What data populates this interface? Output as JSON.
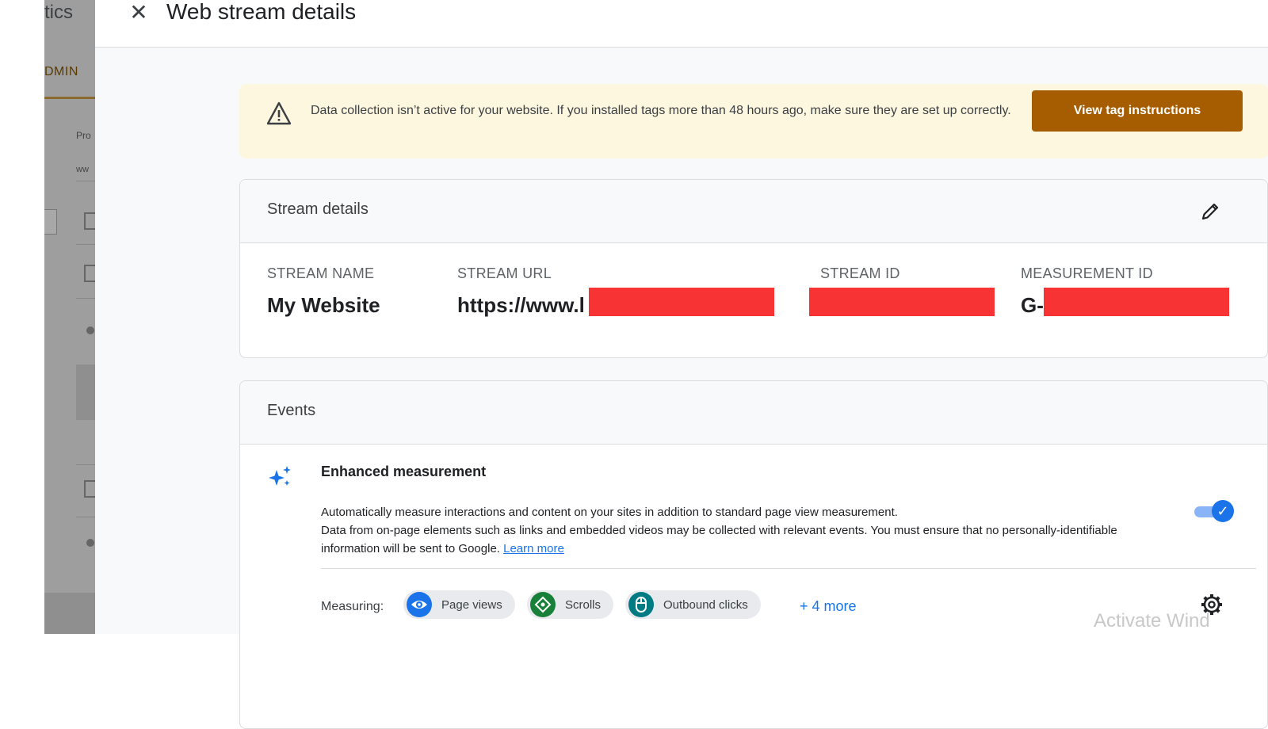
{
  "background_app": {
    "title_fragment": "tics",
    "tab_fragment": "DMIN",
    "label1": "Pro",
    "label2": "ww"
  },
  "panel": {
    "title": "Web stream details",
    "close_symbol": "✕"
  },
  "banner": {
    "message": "Data collection isn’t active for your website. If you installed tags more than 48 hours ago, make sure they are set up correctly.",
    "button_label": "View tag instructions",
    "icon": "warning-triangle-icon"
  },
  "stream_details": {
    "title": "Stream details",
    "fields": [
      {
        "label": "STREAM NAME",
        "value": "My Website"
      },
      {
        "label": "STREAM URL",
        "value": "https://www.l"
      },
      {
        "label": "STREAM ID",
        "value": ""
      },
      {
        "label": "MEASUREMENT ID",
        "value": "G-"
      }
    ]
  },
  "events": {
    "title": "Events",
    "enhanced": {
      "title": "Enhanced measurement",
      "desc_line1": "Automatically measure interactions and content on your sites in addition to standard page view measurement.",
      "desc_line2": "Data from on-page elements such as links and embedded videos may be collected with relevant events. You must ensure that no personally-identifiable information will be sent to Google.",
      "learn_more": "Learn more",
      "enabled": true
    },
    "measuring_label": "Measuring:",
    "chips": [
      {
        "label": "Page views",
        "color": "#1a73e8"
      },
      {
        "label": "Scrolls",
        "color": "#188038"
      },
      {
        "label": "Outbound clicks",
        "color": "#007b83"
      }
    ],
    "more": "+ 4 more"
  },
  "watermark": "Activate Wind",
  "colors": {
    "accent": "#1a73e8",
    "banner_bg": "#fef7e0",
    "banner_button": "#a65c00",
    "redaction": "#f83333"
  }
}
